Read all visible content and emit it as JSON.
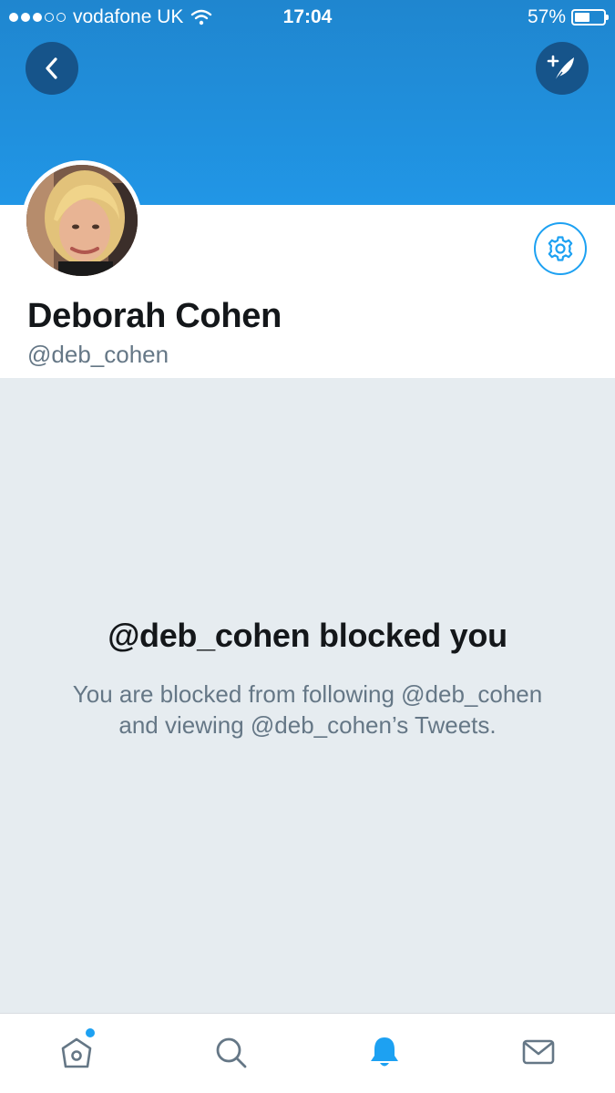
{
  "status_bar": {
    "carrier": "vodafone UK",
    "time": "17:04",
    "battery": "57%",
    "battery_level": 0.57,
    "signal_bars_filled": 3,
    "signal_bars_total": 5
  },
  "profile": {
    "name": "Deborah Cohen",
    "handle": "@deb_cohen"
  },
  "blocked": {
    "title": "@deb_cohen blocked you",
    "description": "You are blocked from following @deb_cohen and viewing @deb_cohen’s Tweets."
  },
  "tabbar": {
    "items": [
      {
        "icon": "home-icon",
        "active": false,
        "badge": true
      },
      {
        "icon": "search-icon",
        "active": false,
        "badge": false
      },
      {
        "icon": "notifications-icon",
        "active": true,
        "badge": false
      },
      {
        "icon": "messages-icon",
        "active": false,
        "badge": false
      }
    ]
  },
  "colors": {
    "header_blue": "#2196e6",
    "button_dark_blue": "#16548a",
    "accent": "#1da1f2",
    "blocked_bg": "#e6ecf0",
    "text_primary": "#14171a",
    "text_secondary": "#657786"
  }
}
